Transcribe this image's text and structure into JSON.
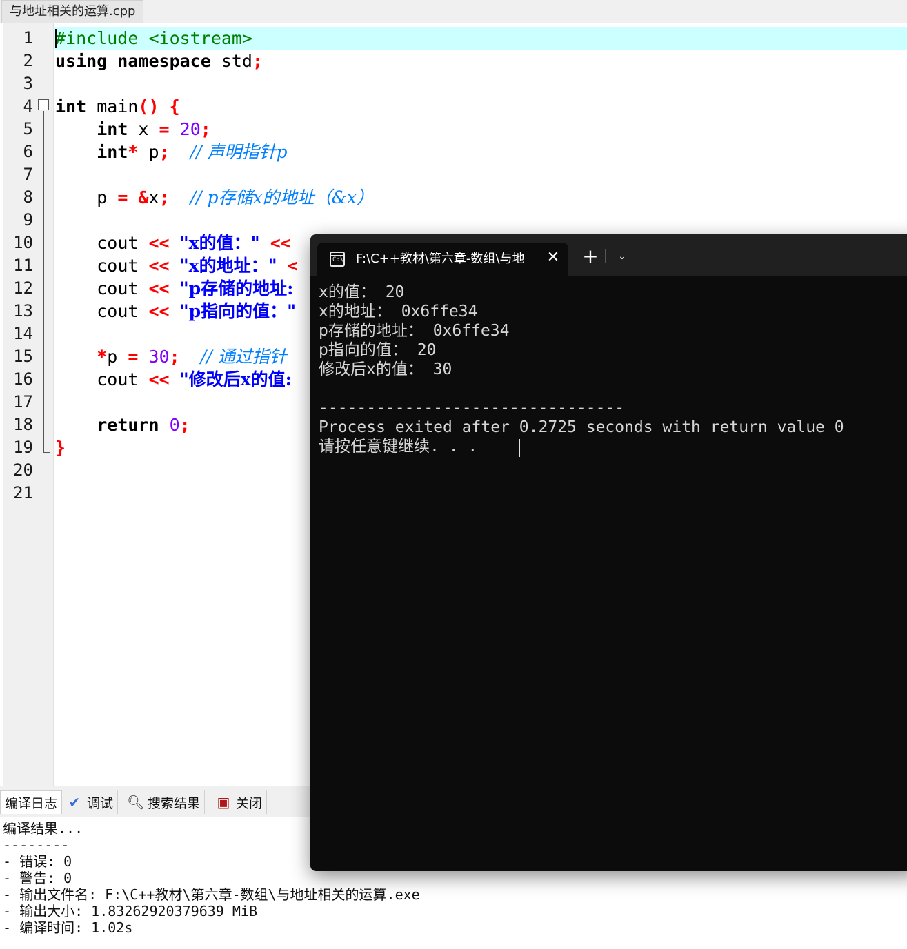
{
  "editor_tab": {
    "filename": "与地址相关的运算.cpp"
  },
  "editor": {
    "line_numbers": [
      "1",
      "2",
      "3",
      "4",
      "5",
      "6",
      "7",
      "8",
      "9",
      "10",
      "11",
      "12",
      "13",
      "14",
      "15",
      "16",
      "17",
      "18",
      "19",
      "20",
      "21"
    ]
  },
  "code": {
    "l1": {
      "pp": "#include <iostream>"
    },
    "l2": {
      "kw": "using namespace",
      "rest": " std",
      "semi": ";"
    },
    "l4": {
      "kw": "int",
      "fn": " main",
      "paren": "()",
      "brace": " {"
    },
    "l5": {
      "indent": "    ",
      "kw": "int",
      "mid": " x ",
      "eq": "=",
      "sp": " ",
      "num": "20",
      "semi": ";"
    },
    "l6": {
      "indent": "    ",
      "kw": "int",
      "star": "*",
      "mid": " p",
      "semi": ";",
      "gap": "  ",
      "cmt": "// 声明指针p"
    },
    "l8": {
      "indent": "    ",
      "mid": "p ",
      "eq": "=",
      "sp": " ",
      "amp": "&",
      "var": "x",
      "semi": ";",
      "gap": "  ",
      "cmt": "// p存储x的地址（&x）"
    },
    "l10": {
      "indent": "    ",
      "mid": "cout ",
      "op": "<<",
      "sp": " ",
      "str": "\"x的值：\"",
      "sp2": " ",
      "op2": "<<"
    },
    "l11": {
      "indent": "    ",
      "mid": "cout ",
      "op": "<<",
      "sp": " ",
      "str": "\"x的地址：\"",
      "sp2": " ",
      "op2": "<"
    },
    "l12": {
      "indent": "    ",
      "mid": "cout ",
      "op": "<<",
      "sp": " ",
      "str": "\"p存储的地址:"
    },
    "l13": {
      "indent": "    ",
      "mid": "cout ",
      "op": "<<",
      "sp": " ",
      "str": "\"p指向的值：\""
    },
    "l15": {
      "indent": "    ",
      "star": "*",
      "mid": "p ",
      "eq": "=",
      "sp": " ",
      "num": "30",
      "semi": ";",
      "gap": "  ",
      "cmt": "// 通过指针"
    },
    "l16": {
      "indent": "    ",
      "mid": "cout ",
      "op": "<<",
      "sp": " ",
      "str": "\"修改后x的值:"
    },
    "l18": {
      "indent": "    ",
      "kw": "return",
      "sp": " ",
      "num": "0",
      "semi": ";"
    },
    "l19": {
      "brace": "}"
    }
  },
  "bottom_tabs": {
    "compile_log": "编译日志",
    "debug": "调试",
    "search_results": "搜索结果",
    "close": "关闭"
  },
  "compile_log": [
    "编译结果...",
    "--------",
    "- 错误: 0",
    "- 警告: 0",
    "- 输出文件名: F:\\C++教材\\第六章-数组\\与地址相关的运算.exe",
    "- 输出大小: 1.83262920379639 MiB",
    "- 编译时间: 1.02s"
  ],
  "terminal": {
    "tab_title": "F:\\C++教材\\第六章-数组\\与地",
    "icon_text": "C:\\",
    "close_glyph": "✕",
    "new_tab_glyph": "+",
    "dropdown_glyph": "⌄",
    "lines": [
      "x的值： 20",
      "x的地址： 0x6ffe34",
      "p存储的地址： 0x6ffe34",
      "p指向的值： 20",
      "修改后x的值： 30",
      "",
      "--------------------------------",
      "Process exited after 0.2725 seconds with return value 0",
      "请按任意键继续. . ."
    ]
  },
  "colors": {
    "current_line": "#ccffff",
    "keyword": "#000000",
    "operator": "#ff0000",
    "number": "#8000ff",
    "preprocessor": "#008000",
    "string": "#0000ff",
    "comment": "#0080ff",
    "terminal_bg": "#0c0c0c",
    "terminal_text": "#d6d6d6"
  }
}
